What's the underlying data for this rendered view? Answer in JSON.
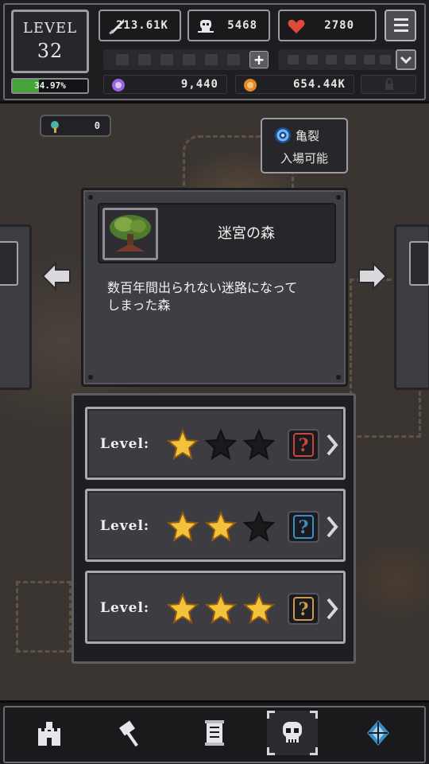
{
  "player": {
    "level_label": "LEVEL",
    "level": "32",
    "xp_percent_text": "34.97%",
    "xp_fraction": 0.3497
  },
  "stats": {
    "attack": {
      "icon": "sword-icon",
      "value": "213.61K"
    },
    "skulls": {
      "icon": "skull-icon",
      "value": "5468"
    },
    "hp": {
      "icon": "heart-icon",
      "value": "2780"
    }
  },
  "currencies": {
    "gems": {
      "icon": "purple-gem-icon",
      "value": "9,440"
    },
    "gold": {
      "icon": "gold-coin-icon",
      "value": "654.44K"
    },
    "locked": {
      "icon": "lock-icon"
    }
  },
  "key_counter": {
    "icon": "key-icon",
    "value": "0"
  },
  "rift": {
    "icon": "rift-swirl-icon",
    "title": "亀裂",
    "subtitle": "入場可能"
  },
  "stage": {
    "name": "迷宮の森",
    "description_line1": "数百年間出られない迷路になって",
    "description_line2": "しまった森",
    "thumbnail": "forest-tree-icon"
  },
  "difficulties": [
    {
      "label": "Level:",
      "stars_filled": 1,
      "stars_total": 3,
      "reward_icon": "mystery-box-red-icon",
      "reward_text": "?"
    },
    {
      "label": "Level:",
      "stars_filled": 2,
      "stars_total": 3,
      "reward_icon": "mystery-box-blue-icon",
      "reward_text": "?"
    },
    {
      "label": "Level:",
      "stars_filled": 3,
      "stars_total": 3,
      "reward_icon": "mystery-box-gold-icon",
      "reward_text": "?"
    }
  ],
  "nav": [
    {
      "icon": "castle-icon"
    },
    {
      "icon": "hammer-icon"
    },
    {
      "icon": "scroll-icon"
    },
    {
      "icon": "skull-icon",
      "active": true
    },
    {
      "icon": "compass-icon"
    }
  ],
  "colors": {
    "xp_bar": "#46a33a",
    "star_filled": "#f3c23a",
    "star_empty": "#1a191c",
    "q_red": "#c8463c",
    "q_blue": "#3a8ec8",
    "q_gold": "#c89a4a",
    "gem": "#9a63e0",
    "gold": "#e08a2a",
    "heart": "#e04a3a"
  }
}
